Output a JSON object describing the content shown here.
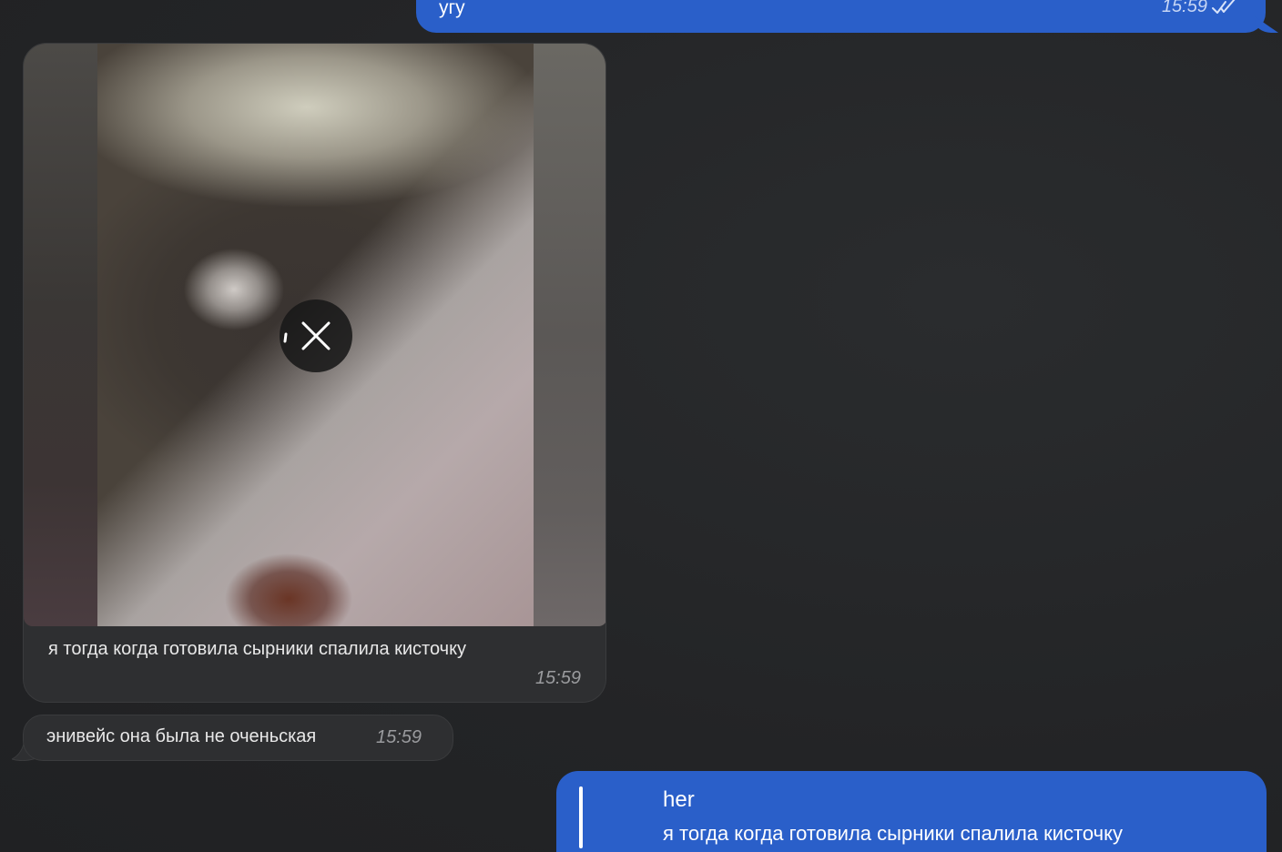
{
  "messages": {
    "top_outgoing": {
      "text": "угу",
      "time": "15:59",
      "status_icon": "double-check-icon"
    },
    "photo_incoming": {
      "caption": "я тогда когда готовила сырники спалила кисточку",
      "time": "15:59",
      "overlay_icon": "close-icon"
    },
    "text_incoming": {
      "text": "энивейс она была не оченьская",
      "time": "15:59"
    },
    "bottom_outgoing": {
      "reply": {
        "name": "her",
        "text": "я тогда когда готовила сырники спалила кисточку"
      }
    }
  },
  "colors": {
    "background": "#262729",
    "outgoing_bubble": "#2a5fc9",
    "incoming_bubble": "#2e2f31",
    "timestamp_incoming": "#9a9b9e",
    "timestamp_outgoing": "#c7d6f5"
  }
}
